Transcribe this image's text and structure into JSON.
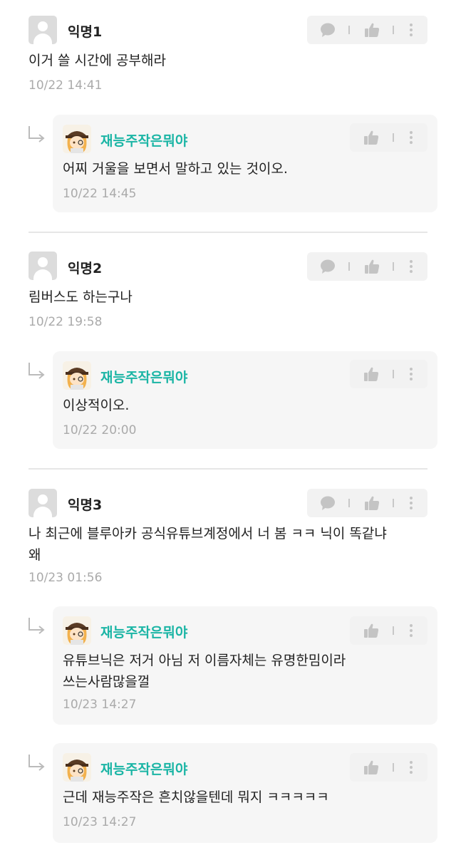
{
  "threads": [
    {
      "comment": {
        "nickname": "익명1",
        "text": "이거 쓸 시간에 공부해라",
        "date": "10/22 14:41"
      },
      "replies": [
        {
          "nickname": "재능주작은뭐야",
          "text": "어찌 거울을 보면서 말하고 있는 것이오.",
          "date": "10/22 14:45"
        }
      ]
    },
    {
      "comment": {
        "nickname": "익명2",
        "text": "림버스도 하는구나",
        "date": "10/22 19:58"
      },
      "replies": [
        {
          "nickname": "재능주작은뭐야",
          "text": "이상적이오.",
          "date": "10/22 20:00"
        }
      ]
    },
    {
      "comment": {
        "nickname": "익명3",
        "text": "나 최근에 블루아카 공식유튜브계정에서 너 봄 ㅋㅋ 닉이 똑같냐\n왜",
        "date": "10/23 01:56"
      },
      "replies": [
        {
          "nickname": "재능주작은뭐야",
          "text": "유튜브닉은 저거 아님 저 이름자체는 유명한밈이라\n쓰는사람많을껄",
          "date": "10/23 14:27"
        },
        {
          "nickname": "재능주작은뭐야",
          "text": "근데 재능주작은 흔치않을텐데 뭐지 ㅋㅋㅋㅋㅋ",
          "date": "10/23 14:27"
        }
      ]
    }
  ],
  "icons": {
    "comment": "speech-bubble-icon",
    "like": "thumbs-up-icon",
    "more": "more-vertical-icon",
    "reply": "reply-arrow-icon"
  },
  "colors": {
    "reply_nickname": "#1bb5a5",
    "meta": "#aaaaaa",
    "reply_bg": "#f6f6f6"
  }
}
